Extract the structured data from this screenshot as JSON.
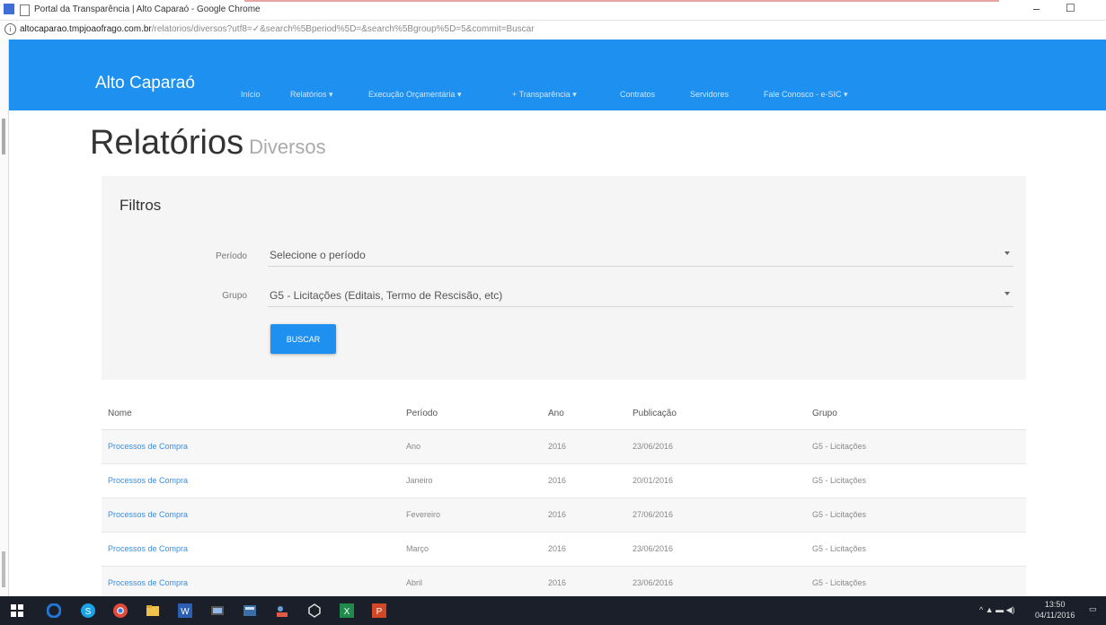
{
  "window": {
    "title": "Portal da Transparência | Alto Caparaó - Google Chrome",
    "minimize": "–",
    "maximize": "☐"
  },
  "address": {
    "host": "altocaparao.tmpjoaofrago.com.br",
    "path": "/relatorios/diversos?utf8=✓&search%5Bperiod%5D=&search%5Bgroup%5D=5&commit=Buscar"
  },
  "navbar": {
    "brand": "Alto Caparaó",
    "items": [
      "Início",
      "Relatórios ▾",
      "Execução Orçamentária ▾",
      "+ Transparência ▾",
      "Contratos",
      "Servidores",
      "Fale Conosco - e-SIC ▾"
    ]
  },
  "page": {
    "title": "Relatórios",
    "subtitle": "Diversos"
  },
  "filters": {
    "title": "Filtros",
    "period_label": "Período",
    "period_value": "Selecione o período",
    "group_label": "Grupo",
    "group_value": "G5 - Licitações (Editais, Termo de Rescisão, etc)",
    "button": "BUSCAR"
  },
  "table": {
    "headers": [
      "Nome",
      "Período",
      "Ano",
      "Publicação",
      "Grupo"
    ],
    "rows": [
      [
        "Processos de Compra",
        "Ano",
        "2016",
        "23/06/2016",
        "G5 - Licitações"
      ],
      [
        "Processos de Compra",
        "Janeiro",
        "2016",
        "20/01/2016",
        "G5 - Licitações"
      ],
      [
        "Processos de Compra",
        "Fevereiro",
        "2016",
        "27/06/2016",
        "G5 - Licitações"
      ],
      [
        "Processos de Compra",
        "Março",
        "2016",
        "23/06/2016",
        "G5 - Licitações"
      ],
      [
        "Processos de Compra",
        "Abril",
        "2016",
        "23/06/2016",
        "G5 - Licitações"
      ]
    ]
  },
  "taskbar": {
    "time": "13:50",
    "date": "04/11/2016",
    "icons": [
      "windows-start-icon",
      "edge-icon",
      "skype-icon",
      "chrome-icon",
      "explorer-icon",
      "word-icon",
      "media-icon",
      "app-icon",
      "people-icon",
      "settings-icon",
      "excel-icon",
      "powerpoint-icon"
    ],
    "colors": {
      "bar": "#1b1f2a",
      "edge": "#1e78d4",
      "skype": "#1aa3e6",
      "chrome": "#e04b3a",
      "word": "#2b5fb4",
      "excel": "#1f8a4c",
      "powerpoint": "#d24726"
    }
  },
  "theme": {
    "primary": "#1e90f0",
    "link": "#3b8de0",
    "panel": "#f5f5f5"
  }
}
